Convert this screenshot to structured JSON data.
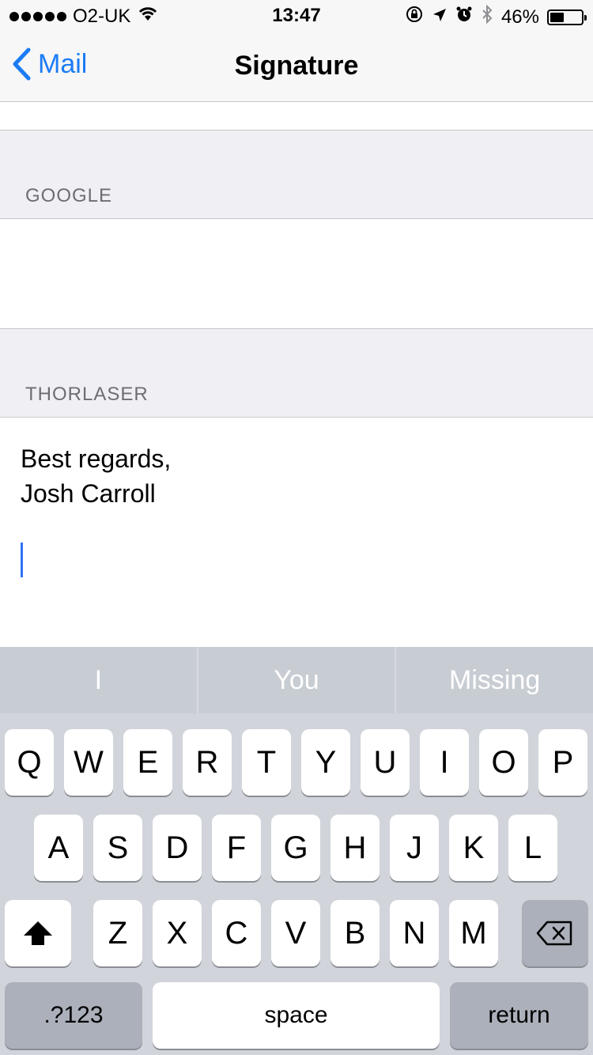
{
  "status_bar": {
    "carrier": "O2-UK",
    "time": "13:47",
    "battery_percent": "46%",
    "battery_level": 0.46,
    "icons": [
      "signal-dots-icon",
      "wifi-icon",
      "orientation-lock-icon",
      "location-arrow-icon",
      "alarm-icon",
      "bluetooth-icon",
      "battery-icon"
    ]
  },
  "navbar": {
    "back_label": "Mail",
    "title": "Signature"
  },
  "sections": [
    {
      "label": "GOOGLE",
      "text": ""
    },
    {
      "label": "THORLASER",
      "lines": [
        "Best regards,",
        "Josh Carroll"
      ]
    }
  ],
  "keyboard": {
    "suggestions": [
      "I",
      "You",
      "Missing"
    ],
    "row1": [
      "Q",
      "W",
      "E",
      "R",
      "T",
      "Y",
      "U",
      "I",
      "O",
      "P"
    ],
    "row2": [
      "A",
      "S",
      "D",
      "F",
      "G",
      "H",
      "J",
      "K",
      "L"
    ],
    "row3": [
      "Z",
      "X",
      "C",
      "V",
      "B",
      "N",
      "M"
    ],
    "numbers_label": ".?123",
    "space_label": "space",
    "return_label": "return"
  },
  "colors": {
    "accent": "#1b7cf5",
    "caret": "#2e73f6"
  }
}
